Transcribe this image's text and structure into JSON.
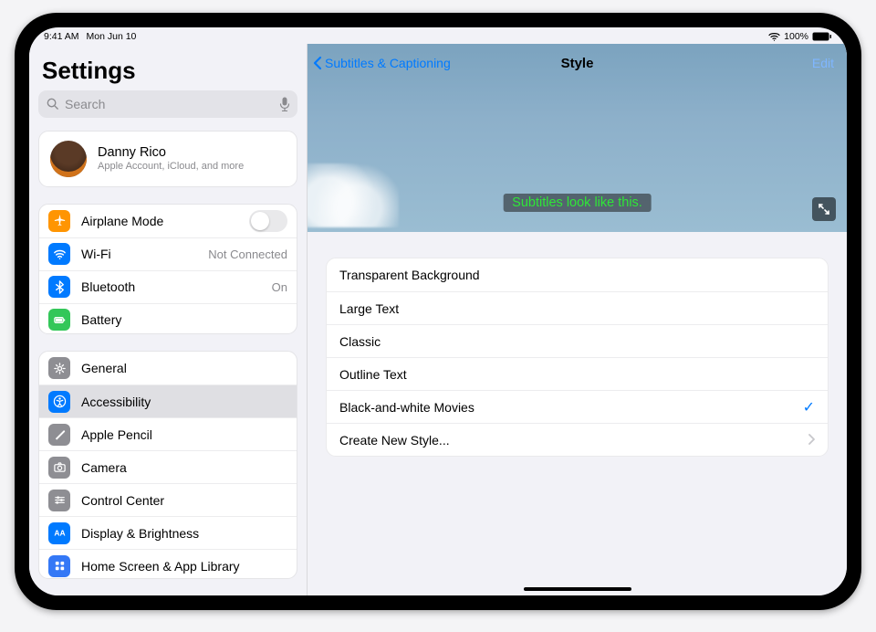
{
  "statusbar": {
    "time": "9:41 AM",
    "date": "Mon Jun 10",
    "battery": "100%"
  },
  "sidebar": {
    "title": "Settings",
    "search_placeholder": "Search",
    "profile": {
      "name": "Danny Rico",
      "sub": "Apple Account, iCloud, and more"
    },
    "group1": {
      "airplane": "Airplane Mode",
      "wifi": "Wi-Fi",
      "wifi_value": "Not Connected",
      "bt": "Bluetooth",
      "bt_value": "On",
      "battery": "Battery"
    },
    "group2": {
      "general": "General",
      "accessibility": "Accessibility",
      "pencil": "Apple Pencil",
      "camera": "Camera",
      "control": "Control Center",
      "display": "Display & Brightness",
      "home": "Home Screen & App Library"
    }
  },
  "detail": {
    "back": "Subtitles & Captioning",
    "title": "Style",
    "edit": "Edit",
    "preview_text": "Subtitles look like this.",
    "styles": {
      "transparent": "Transparent Background",
      "large": "Large Text",
      "classic": "Classic",
      "outline": "Outline Text",
      "bw": "Black-and-white Movies",
      "create": "Create New Style..."
    }
  }
}
